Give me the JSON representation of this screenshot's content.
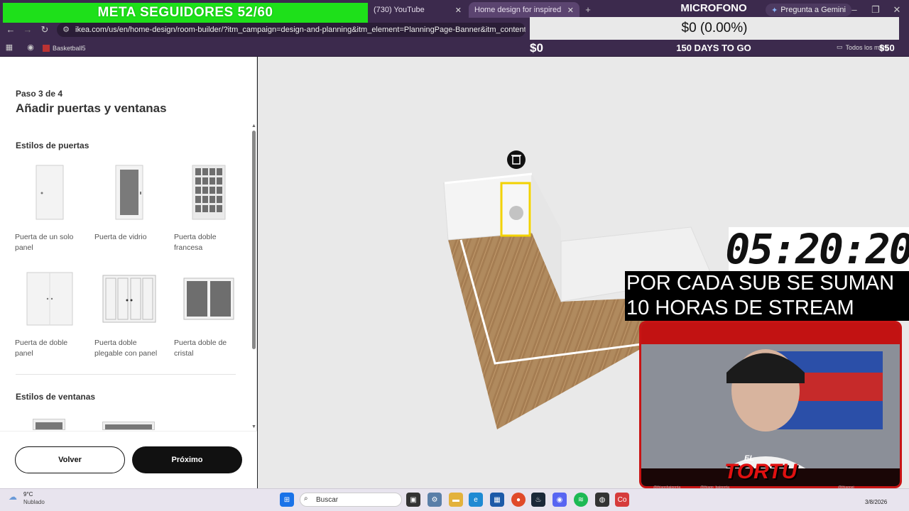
{
  "browser": {
    "tabs": [
      {
        "label": "(730) YouTube"
      },
      {
        "label": "Home design for inspired living"
      }
    ],
    "gemini_label": "Pregunta a Gemini",
    "url": "ikea.com/us/en/home-design/room-builder/?itm_campaign=design-and-planning&itm_element=PlanningPage-Banner&itm_content=kreativ",
    "bookmark": "Basketball5",
    "all_bookmarks": "Todos los marcadores"
  },
  "overlay": {
    "meta": "META SEGUIDORES 52/60",
    "mic": "MICROFONO",
    "donation": "$0 (0.00%)",
    "don_left": "$0",
    "don_mid": "150 DAYS TO GO",
    "don_right": "$50",
    "timer": "05:20:20",
    "sub_line1": "POR CADA SUB SE SUMAN",
    "sub_line2": "10 HORAS DE STREAM",
    "brand_top": "EL",
    "brand": "TORTU",
    "handle1": "@thiagobaigorria_",
    "handle2": "@thiago_baigorria",
    "handle3": "@thiagoei_"
  },
  "panel": {
    "step": "Paso 3 de 4",
    "title": "Añadir puertas y ventanas",
    "doors_heading": "Estilos de puertas",
    "doors": [
      {
        "label": "Puerta de un solo panel"
      },
      {
        "label": "Puerta de vidrio"
      },
      {
        "label": "Puerta doble francesa"
      },
      {
        "label": "Puerta de doble panel"
      },
      {
        "label": "Puerta doble plegable con panel"
      },
      {
        "label": "Puerta doble de cristal"
      }
    ],
    "windows_heading": "Estilos de ventanas",
    "back": "Volver",
    "next": "Próximo"
  },
  "taskbar": {
    "temp": "9°C",
    "weather": "Nublado",
    "search": "Buscar",
    "date": "3/8/2026"
  }
}
